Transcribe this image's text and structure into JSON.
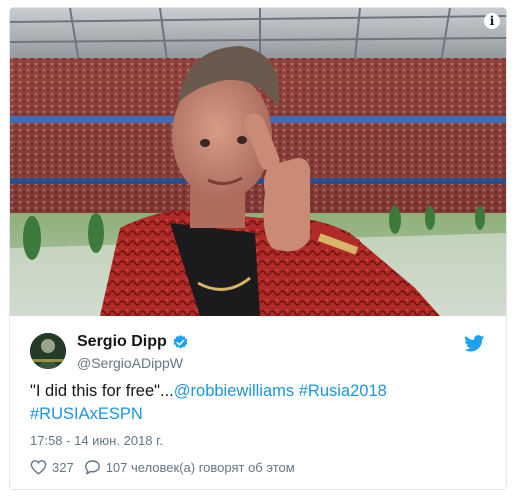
{
  "tweet": {
    "author_name": "Sergio Dipp",
    "author_handle": "@SergioADippW",
    "text_plain": "\"I did this for free\"...",
    "mention": "@robbiewilliams",
    "hashtag_1": "#Rusia2018",
    "hashtag_2": "#RUSIAxESPN",
    "timestamp": "17:58 - 14 июн. 2018 г.",
    "likes": "327",
    "replies": "107 человек(а) говорят об этом"
  },
  "media": {
    "info_glyph": "i"
  },
  "icons": {
    "info": "info-icon",
    "verified": "verified-badge-icon",
    "brand": "twitter-bird-icon",
    "like": "heart-icon",
    "reply": "speech-bubble-icon"
  },
  "colors": {
    "link": "#1b95e0",
    "text": "#14171a",
    "muted": "#657786",
    "border": "#e1e8ed",
    "verified": "#1da1f2"
  }
}
